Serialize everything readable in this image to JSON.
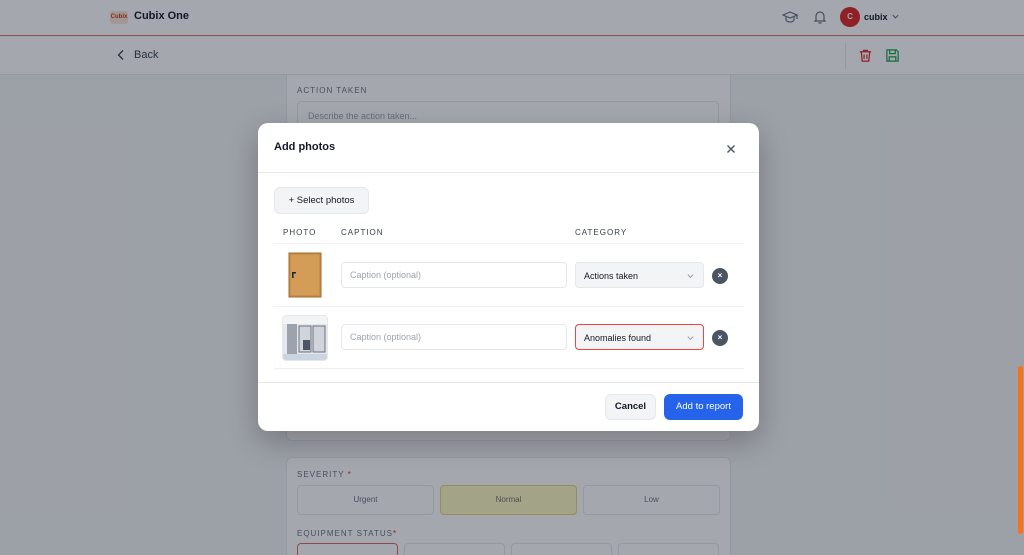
{
  "app": {
    "logo_text": "Cubix",
    "title": "Cubix One"
  },
  "user": {
    "initial": "C",
    "name": "cubix"
  },
  "subbar": {
    "back_label": "Back"
  },
  "form": {
    "action_taken_label": "ACTION TAKEN",
    "action_taken_placeholder": "Describe the action taken...",
    "severity_label": "SEVERITY",
    "severity_options": [
      "Urgent",
      "Normal",
      "Low"
    ],
    "severity_selected": "Normal",
    "equipment_status_label": "EQUIPMENT STATUS",
    "required_mark": "*"
  },
  "modal": {
    "title": "Add photos",
    "select_photos_label": "+ Select photos",
    "columns": {
      "photo": "PHOTO",
      "caption": "CAPTION",
      "category": "CATEGORY"
    },
    "rows": [
      {
        "caption_value": "",
        "caption_placeholder": "Caption (optional)",
        "category": "Actions taken",
        "error": false
      },
      {
        "caption_value": "",
        "caption_placeholder": "Caption (optional)",
        "category": "Anomalies found",
        "error": true
      }
    ],
    "remove_glyph": "×",
    "cancel_label": "Cancel",
    "add_label": "Add to report"
  },
  "colors": {
    "accent_blue": "#2563eb",
    "brand_orange": "#f97316",
    "error_red": "#ef4444",
    "severity_selected_bg": "#fef9c3"
  },
  "icons": [
    "cubix-logo",
    "graduation-cap-icon",
    "bell-icon",
    "chevron-down-icon",
    "chevron-left-icon",
    "trash-icon",
    "save-icon",
    "close-icon",
    "remove-icon"
  ]
}
